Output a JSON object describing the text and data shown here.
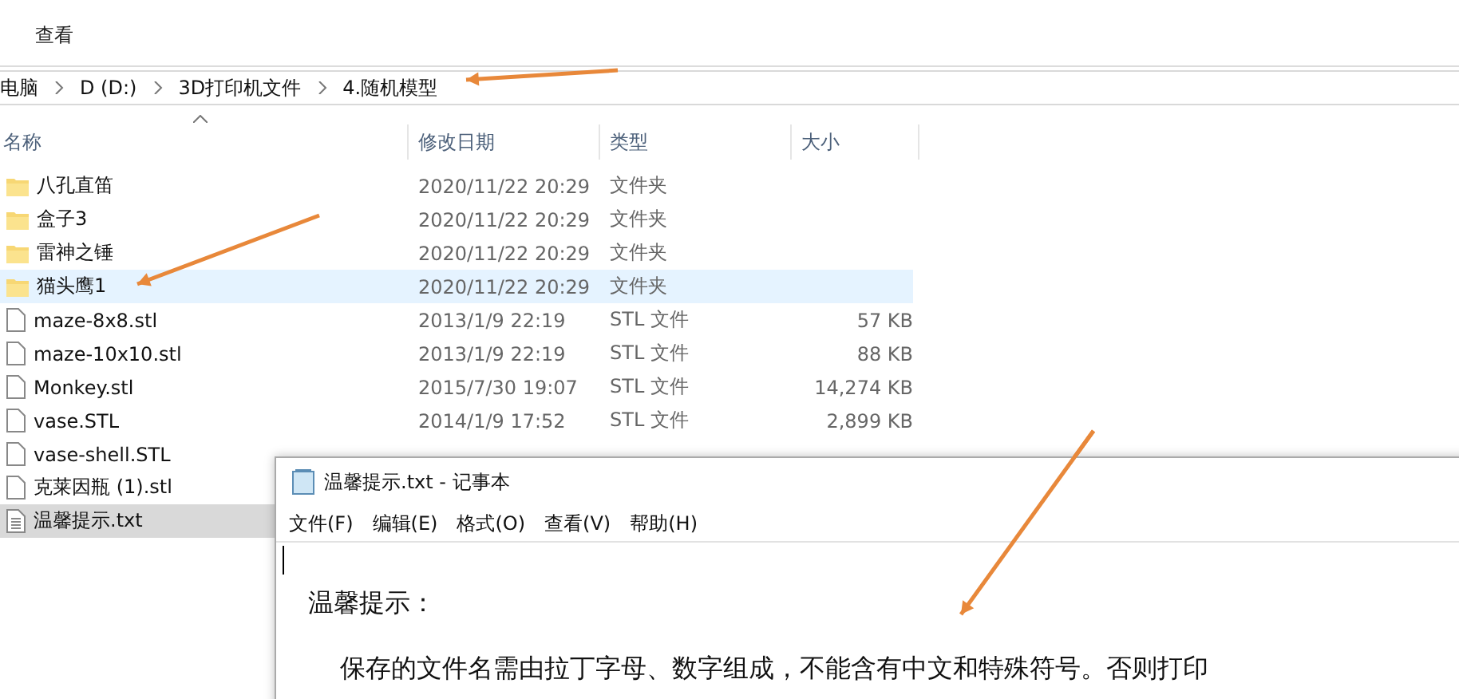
{
  "ribbon": {
    "tabs": [
      {
        "label": "查看"
      }
    ]
  },
  "breadcrumb": [
    "电脑",
    "D (D:)",
    "3D打印机文件",
    "4.随机模型"
  ],
  "columns": [
    "名称",
    "修改日期",
    "类型",
    "大小"
  ],
  "files": [
    {
      "kind": "folder",
      "name": "八孔直笛",
      "modified": "2020/11/22 20:29",
      "type": "文件夹",
      "selected": false,
      "hovered": false
    },
    {
      "kind": "folder",
      "name": "盒子3",
      "modified": "2020/11/22 20:29",
      "type": "文件夹",
      "selected": false,
      "hovered": false
    },
    {
      "kind": "folder",
      "name": "雷神之锤",
      "modified": "2020/11/22 20:29",
      "type": "文件夹",
      "selected": false,
      "hovered": false
    },
    {
      "kind": "folder",
      "name": "猫头鹰1",
      "modified": "2020/11/22 20:29",
      "type": "文件夹",
      "selected": false,
      "hovered": true
    },
    {
      "kind": "file",
      "name": "maze-8x8.stl",
      "modified": "2013/1/9 22:19",
      "type": "STL 文件",
      "size": "57 KB",
      "selected": false,
      "hovered": false
    },
    {
      "kind": "file",
      "name": "maze-10x10.stl",
      "modified": "2013/1/9 22:19",
      "type": "STL 文件",
      "size": "88 KB",
      "selected": false,
      "hovered": false
    },
    {
      "kind": "file",
      "name": "Monkey.stl",
      "modified": "2015/7/30 19:07",
      "type": "STL 文件",
      "size": "14,274 KB",
      "selected": false,
      "hovered": false
    },
    {
      "kind": "file",
      "name": "vase.STL",
      "modified": "2014/1/9 17:52",
      "type": "STL 文件",
      "size": "2,899 KB",
      "selected": false,
      "hovered": false
    },
    {
      "kind": "file",
      "name": "vase-shell.STL",
      "selected": false,
      "hovered": false
    },
    {
      "kind": "file",
      "name": "克莱因瓶 (1).stl",
      "selected": false,
      "hovered": false
    },
    {
      "kind": "text",
      "name": "温馨提示.txt",
      "selected": true,
      "hovered": false
    }
  ],
  "notepad": {
    "title": "温馨提示.txt - 记事本",
    "menu": [
      "文件(F)",
      "编辑(E)",
      "格式(O)",
      "查看(V)",
      "帮助(H)"
    ],
    "heading": "温馨提示：",
    "paragraph": "保存的文件名需由拉丁字母、数字组成，不能含有中文和特殊符号。否则打印"
  }
}
